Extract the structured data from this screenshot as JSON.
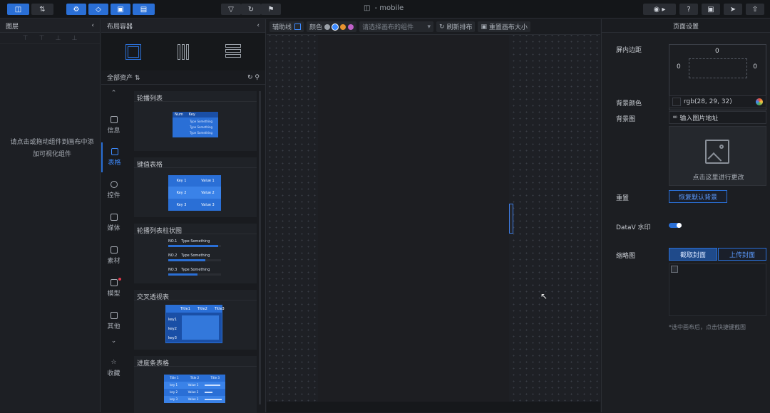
{
  "app": {
    "title": "- mobile"
  },
  "topbar": {
    "left_buttons": [
      {
        "icon": "layer-icon"
      },
      {
        "icon": "component-icon"
      }
    ],
    "mid_buttons": [
      {
        "icon": "settings-icon"
      },
      {
        "icon": "cube-icon"
      },
      {
        "icon": "panel-icon"
      },
      {
        "icon": "save-icon"
      }
    ],
    "center_buttons": [
      {
        "icon": "filter-icon"
      },
      {
        "icon": "refresh-icon"
      },
      {
        "icon": "flag-icon"
      }
    ],
    "right_buttons": [
      {
        "icon": "camera-icon"
      },
      {
        "icon": "help-icon"
      },
      {
        "icon": "window-icon"
      },
      {
        "icon": "send-icon"
      },
      {
        "icon": "upload-icon"
      }
    ]
  },
  "layers_panel": {
    "title": "图层",
    "empty_message": "请点击或拖动组件到画布中添加可视化组件"
  },
  "components_panel": {
    "title": "布局容器",
    "asset_filter": "全部资产",
    "categories": [
      {
        "label": "信息",
        "icon": "info-icon",
        "active": false
      },
      {
        "label": "表格",
        "icon": "table-icon",
        "active": true
      },
      {
        "label": "控件",
        "icon": "control-icon",
        "active": false
      },
      {
        "label": "媒体",
        "icon": "media-icon",
        "active": false
      },
      {
        "label": "素材",
        "icon": "material-icon",
        "active": false
      },
      {
        "label": "模型",
        "icon": "model-icon",
        "active": false
      },
      {
        "label": "其他",
        "icon": "other-icon",
        "active": false
      },
      {
        "label": "收藏",
        "icon": "star-icon",
        "active": false
      }
    ],
    "cards": [
      {
        "title": "轮播列表",
        "preview": {
          "header": [
            "Num",
            "Key"
          ],
          "rows": [
            "Type Something",
            "Type Something",
            "Type Something"
          ]
        }
      },
      {
        "title": "键值表格",
        "preview": {
          "rows": [
            [
              "Key 1",
              "Value 1"
            ],
            [
              "Key 2",
              "Value 2"
            ],
            [
              "Key 3",
              "Value 3"
            ]
          ]
        }
      },
      {
        "title": "轮播列表柱状图",
        "preview": {
          "rows": [
            {
              "label": "NO.1",
              "text": "Type Something",
              "progress": 0.95
            },
            {
              "label": "NO.2",
              "text": "Type Something",
              "progress": 0.7
            },
            {
              "label": "NO.3",
              "text": "Type Something",
              "progress": 0.55
            }
          ]
        }
      },
      {
        "title": "交叉透视表",
        "preview": {
          "header": [
            "Title1",
            "Title2",
            "Title3"
          ],
          "rows": [
            "key1",
            "key2",
            "key3"
          ]
        }
      },
      {
        "title": "进度条表格",
        "preview": {
          "header": [
            "Title 1",
            "Title 2",
            "Title 3"
          ],
          "rows": [
            [
              "key 1",
              "Value 1"
            ],
            [
              "key 2",
              "Value 2"
            ],
            [
              "key 3",
              "Value 3"
            ]
          ]
        }
      }
    ]
  },
  "canvas_toolbar": {
    "guides_label": "辅助线",
    "color_label": "颜色",
    "colors": [
      "#9aa0a8",
      "#3d8bff",
      "#e8932f",
      "#c061c9"
    ],
    "pick_placeholder": "请选择画布的组件",
    "rearrange_label": "刷新排布",
    "reset_label": "重置画布大小"
  },
  "props_panel": {
    "title": "页面设置",
    "margin_label": "屏内边距",
    "margins": {
      "top": "0",
      "right": "0",
      "bottom": "0",
      "left": "0"
    },
    "bg_color_label": "背景颜色",
    "bg_color_value": "rgb(28, 29, 32)",
    "bg_image_label": "背景图",
    "bg_image_input": "输入图片地址",
    "bg_upload_hint": "点击这里进行更改",
    "reset_label": "重置",
    "reset_button": "恢复默认背景",
    "watermark_label": "DataV 水印",
    "thumbnail_label": "缩略图",
    "capture_button": "截取封面",
    "upload_button": "上传封面",
    "thumbnail_hint": "*选中画布后，点击快捷键截图"
  }
}
